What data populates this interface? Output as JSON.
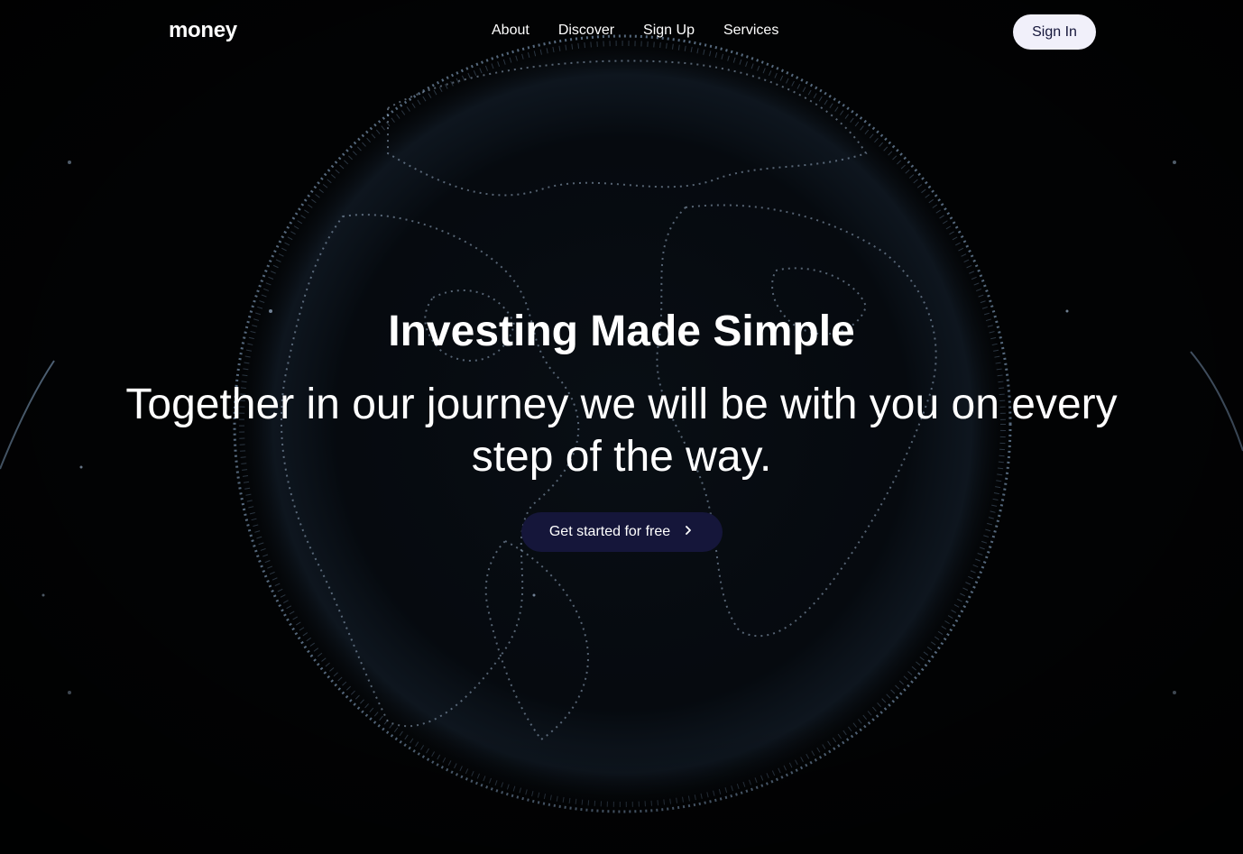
{
  "header": {
    "logo": "money",
    "nav": [
      {
        "label": "About"
      },
      {
        "label": "Discover"
      },
      {
        "label": "Sign Up"
      },
      {
        "label": "Services"
      }
    ],
    "signin_label": "Sign In"
  },
  "hero": {
    "title": "Investing Made Simple",
    "subtitle": "Together in our journey we will be with you on every step of the way.",
    "cta_label": "Get started for free",
    "cta_icon": "chevron-right-icon"
  },
  "colors": {
    "background": "#020304",
    "cta_bg": "#15163a",
    "signin_bg": "#f1f0fa",
    "globe_dots": "#b7d1ee"
  }
}
